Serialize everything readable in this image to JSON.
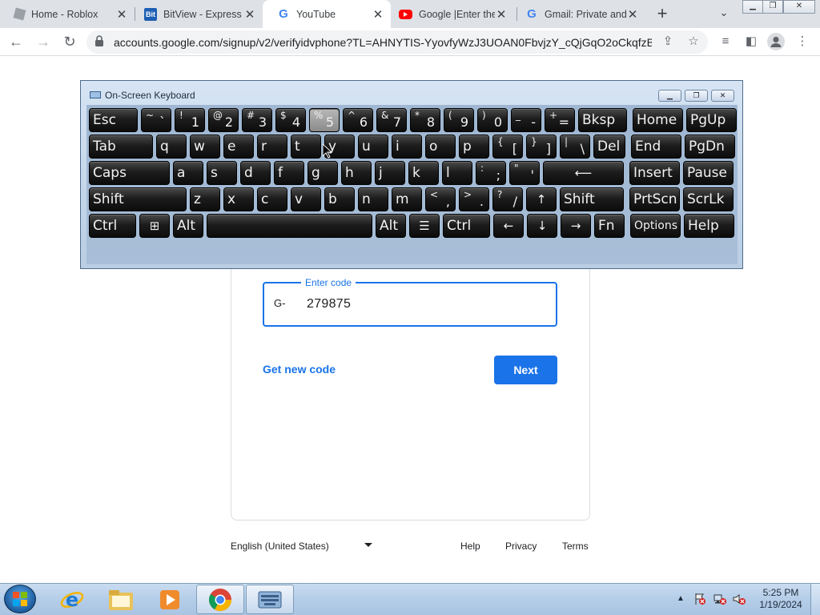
{
  "browser": {
    "tabs": [
      {
        "title": "Home - Roblox",
        "favicon": "roblox-icon"
      },
      {
        "title": "BitView - Express",
        "favicon": "bitview-icon"
      },
      {
        "title": "YouTube",
        "favicon": "google-icon",
        "active": true
      },
      {
        "title": "Google |Enter the",
        "favicon": "youtube-icon"
      },
      {
        "title": "Gmail: Private and",
        "favicon": "google-icon"
      }
    ],
    "new_tab_label": "+",
    "url": "accounts.google.com/signup/v2/verifyidvphone?TL=AHNYTIS-YyovfyWzJ3UOAN0FbvjzY_cQjGqO2oCkqfzB..."
  },
  "page": {
    "code_field": {
      "label": "Enter code",
      "prefix": "G-",
      "value": "279875"
    },
    "get_new_code_label": "Get new code",
    "next_label": "Next",
    "footer": {
      "language": "English (United States)",
      "links": [
        "Help",
        "Privacy",
        "Terms"
      ]
    }
  },
  "osk": {
    "title": "On-Screen Keyboard",
    "rows": [
      [
        {
          "name": "esc",
          "label": "Esc"
        },
        {
          "name": "backtick",
          "shift": "~",
          "base": "`"
        },
        {
          "name": "1",
          "shift": "!",
          "base": "1"
        },
        {
          "name": "2",
          "shift": "@",
          "base": "2"
        },
        {
          "name": "3",
          "shift": "#",
          "base": "3"
        },
        {
          "name": "4",
          "shift": "$",
          "base": "4"
        },
        {
          "name": "5",
          "shift": "%",
          "base": "5"
        },
        {
          "name": "6",
          "shift": "^",
          "base": "6"
        },
        {
          "name": "7",
          "shift": "&",
          "base": "7"
        },
        {
          "name": "8",
          "shift": "*",
          "base": "8"
        },
        {
          "name": "9",
          "shift": "(",
          "base": "9"
        },
        {
          "name": "0",
          "shift": ")",
          "base": "0"
        },
        {
          "name": "minus",
          "shift": "_",
          "base": "-"
        },
        {
          "name": "equals",
          "shift": "+",
          "base": "="
        },
        {
          "name": "backspace",
          "label": "Bksp"
        },
        {
          "name": "home",
          "label": "Home"
        },
        {
          "name": "pgup",
          "label": "PgUp"
        }
      ],
      [
        {
          "name": "tab",
          "label": "Tab"
        },
        {
          "name": "q",
          "label": "q"
        },
        {
          "name": "w",
          "label": "w"
        },
        {
          "name": "e",
          "label": "e"
        },
        {
          "name": "r",
          "label": "r"
        },
        {
          "name": "t",
          "label": "t"
        },
        {
          "name": "y",
          "label": "y"
        },
        {
          "name": "u",
          "label": "u"
        },
        {
          "name": "i",
          "label": "i"
        },
        {
          "name": "o",
          "label": "o"
        },
        {
          "name": "p",
          "label": "p"
        },
        {
          "name": "lbracket",
          "shift": "{",
          "base": "["
        },
        {
          "name": "rbracket",
          "shift": "}",
          "base": "]"
        },
        {
          "name": "backslash",
          "shift": "|",
          "base": "\\"
        },
        {
          "name": "del",
          "label": "Del"
        },
        {
          "name": "end",
          "label": "End"
        },
        {
          "name": "pgdn",
          "label": "PgDn"
        }
      ],
      [
        {
          "name": "caps",
          "label": "Caps"
        },
        {
          "name": "a",
          "label": "a"
        },
        {
          "name": "s",
          "label": "s"
        },
        {
          "name": "d",
          "label": "d"
        },
        {
          "name": "f",
          "label": "f"
        },
        {
          "name": "g",
          "label": "g"
        },
        {
          "name": "h",
          "label": "h"
        },
        {
          "name": "j",
          "label": "j"
        },
        {
          "name": "k",
          "label": "k"
        },
        {
          "name": "l",
          "label": "l"
        },
        {
          "name": "semicolon",
          "shift": ":",
          "base": ";"
        },
        {
          "name": "quote",
          "shift": "\"",
          "base": "'"
        },
        {
          "name": "enter",
          "label": "⟵"
        },
        {
          "name": "insert",
          "label": "Insert"
        },
        {
          "name": "pause",
          "label": "Pause"
        }
      ],
      [
        {
          "name": "lshift",
          "label": "Shift"
        },
        {
          "name": "z",
          "label": "z"
        },
        {
          "name": "x",
          "label": "x"
        },
        {
          "name": "c",
          "label": "c"
        },
        {
          "name": "v",
          "label": "v"
        },
        {
          "name": "b",
          "label": "b"
        },
        {
          "name": "n",
          "label": "n"
        },
        {
          "name": "m",
          "label": "m"
        },
        {
          "name": "comma",
          "shift": "<",
          "base": ","
        },
        {
          "name": "period",
          "shift": ">",
          "base": "."
        },
        {
          "name": "slash",
          "shift": "?",
          "base": "/"
        },
        {
          "name": "up",
          "label": "↑"
        },
        {
          "name": "rshift",
          "label": "Shift"
        },
        {
          "name": "prtscn",
          "label": "PrtScn"
        },
        {
          "name": "scrlk",
          "label": "ScrLk"
        }
      ],
      [
        {
          "name": "lctrl",
          "label": "Ctrl"
        },
        {
          "name": "win",
          "label": "⊞"
        },
        {
          "name": "lalt",
          "label": "Alt"
        },
        {
          "name": "space",
          "label": ""
        },
        {
          "name": "ralt",
          "label": "Alt"
        },
        {
          "name": "menu",
          "label": "☰"
        },
        {
          "name": "rctrl",
          "label": "Ctrl"
        },
        {
          "name": "left",
          "label": "←"
        },
        {
          "name": "down",
          "label": "↓"
        },
        {
          "name": "right",
          "label": "→"
        },
        {
          "name": "fn",
          "label": "Fn"
        },
        {
          "name": "options",
          "label": "Options"
        },
        {
          "name": "help",
          "label": "Help"
        }
      ]
    ],
    "pressed_key": "5"
  },
  "taskbar": {
    "apps": [
      "internet-explorer-icon",
      "file-explorer-icon",
      "media-player-icon",
      "chrome-icon",
      "on-screen-keyboard-icon"
    ],
    "active_app": "chrome-icon",
    "time": "5:25 PM",
    "date": "1/19/2024"
  },
  "colors": {
    "accent": "#1a73e8",
    "tabstrip": "#dee1e6",
    "osk_frame": "#b9cde3"
  }
}
